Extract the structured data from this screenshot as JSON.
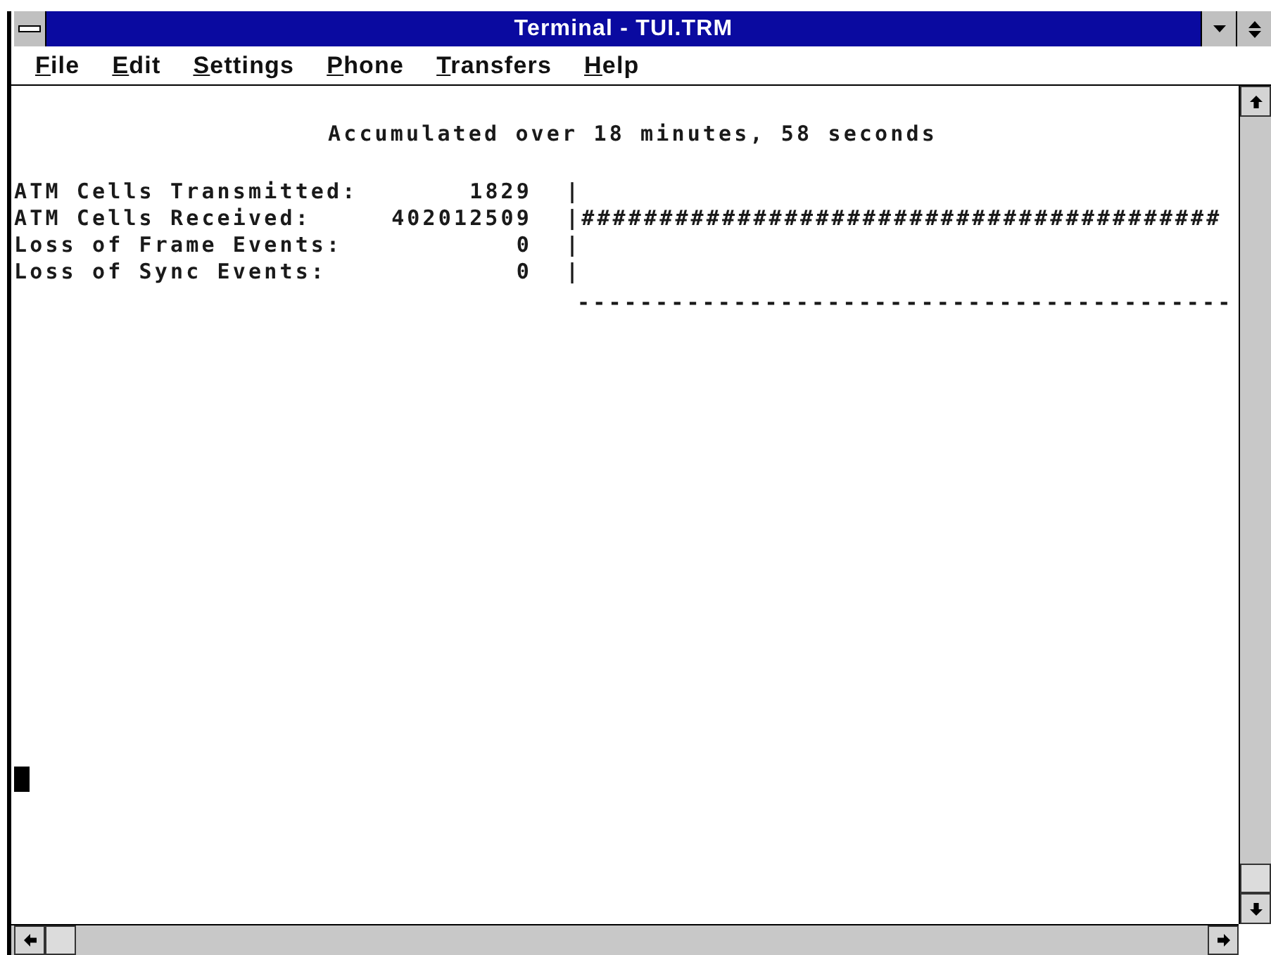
{
  "window": {
    "title": "Terminal - TUI.TRM"
  },
  "menu_bar": [
    "File",
    "Edit",
    "Settings",
    "Phone",
    "Transfers",
    "Help"
  ],
  "terminal": {
    "heading": "Accumulated over 18 minutes, 58 seconds",
    "stats": [
      {
        "label": "ATM Cells Transmitted:",
        "value": "1829",
        "bar": "|"
      },
      {
        "label": "ATM Cells Received:",
        "value": "402012509",
        "bar": "|#########################################"
      },
      {
        "label": "Loss of Frame Events:",
        "value": "0",
        "bar": "|"
      },
      {
        "label": "Loss of Sync Events:",
        "value": "0",
        "bar": "|"
      }
    ],
    "baseline": "------------------------------------------"
  }
}
